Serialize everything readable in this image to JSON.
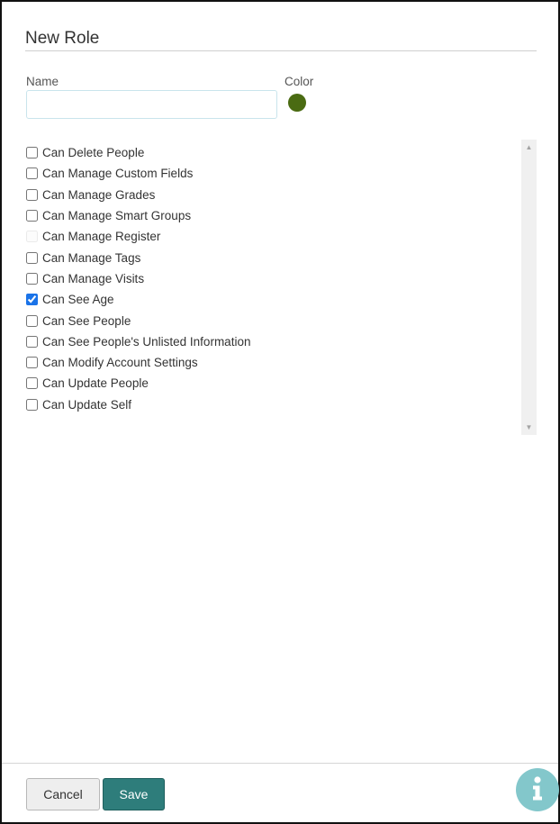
{
  "dialog": {
    "title": "New Role"
  },
  "form": {
    "name_label": "Name",
    "name_value": "",
    "name_placeholder": "",
    "color_label": "Color",
    "color_value": "#4a6b12"
  },
  "permissions": [
    {
      "label": "Can Delete People",
      "checked": false,
      "disabled": false
    },
    {
      "label": "Can Manage Custom Fields",
      "checked": false,
      "disabled": false
    },
    {
      "label": "Can Manage Grades",
      "checked": false,
      "disabled": false
    },
    {
      "label": "Can Manage Smart Groups",
      "checked": false,
      "disabled": false
    },
    {
      "label": "Can Manage Register",
      "checked": false,
      "disabled": true
    },
    {
      "label": "Can Manage Tags",
      "checked": false,
      "disabled": false
    },
    {
      "label": "Can Manage Visits",
      "checked": false,
      "disabled": false
    },
    {
      "label": "Can See Age",
      "checked": true,
      "disabled": false
    },
    {
      "label": "Can See People",
      "checked": false,
      "disabled": false
    },
    {
      "label": "Can See People's Unlisted Information",
      "checked": false,
      "disabled": false
    },
    {
      "label": "Can Modify Account Settings",
      "checked": false,
      "disabled": false
    },
    {
      "label": "Can Update People",
      "checked": false,
      "disabled": false
    },
    {
      "label": "Can Update Self",
      "checked": false,
      "disabled": false
    }
  ],
  "footer": {
    "cancel_label": "Cancel",
    "save_label": "Save",
    "info_icon": "info-icon"
  },
  "colors": {
    "save_button": "#2e7d7b",
    "info_button": "#83c7cb",
    "checkbox_accent": "#1a73e8"
  }
}
